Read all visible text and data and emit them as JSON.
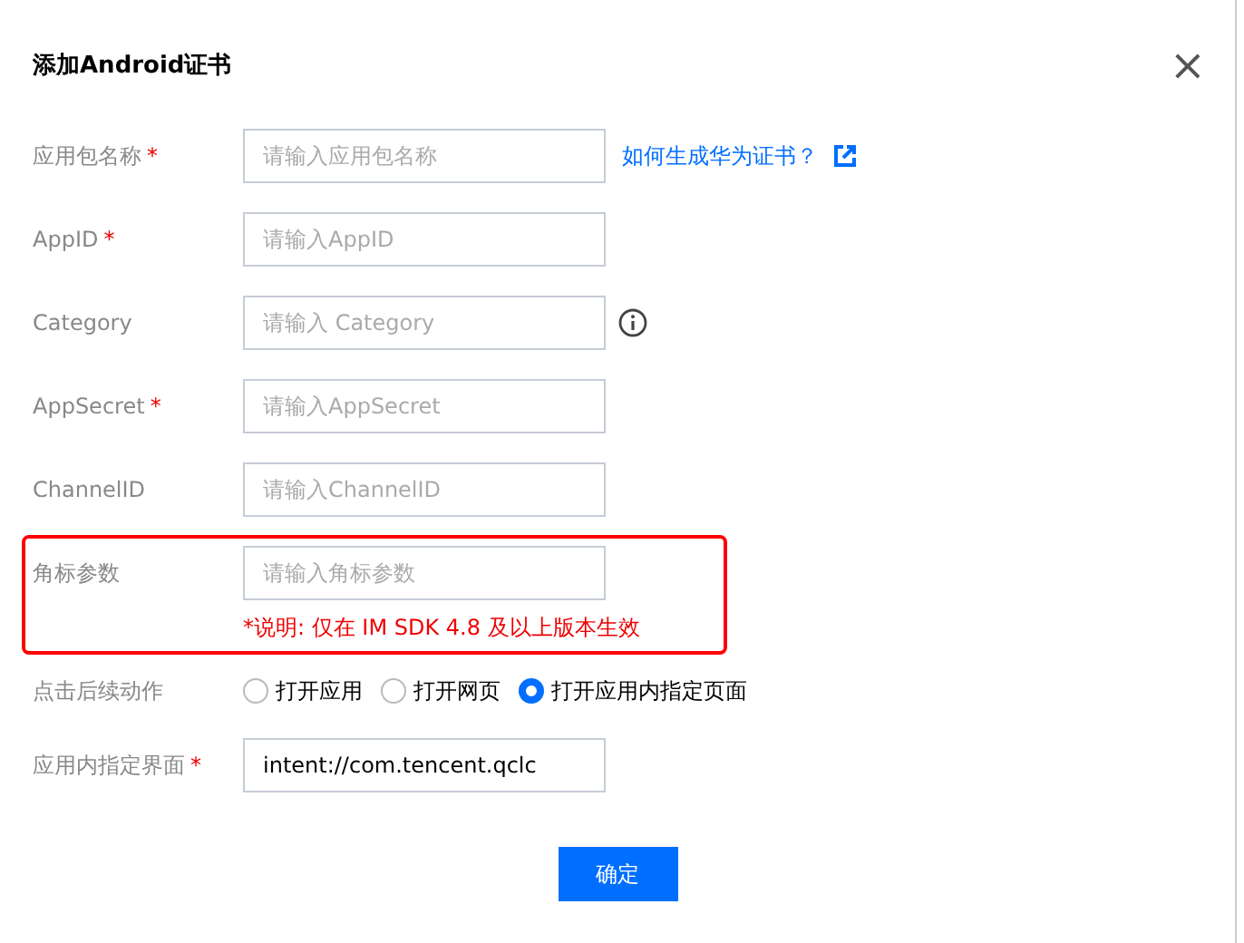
{
  "dialog": {
    "title": "添加Android证书",
    "close": "×"
  },
  "fields": [
    {
      "label": "应用包名称",
      "required": "*",
      "placeholder": "请输入应用包名称",
      "link": "如何生成华为证书？"
    },
    {
      "label": "AppID",
      "required": "*",
      "placeholder": "请输入AppID"
    },
    {
      "label": "Category",
      "placeholder": "请输入 Category",
      "info": true
    },
    {
      "label": "AppSecret",
      "required": "*",
      "placeholder": "请输入AppSecret"
    },
    {
      "label": "ChannelID",
      "placeholder": "请输入ChannelID"
    },
    {
      "label": "角标参数",
      "placeholder": "请输入角标参数",
      "highlighted": true,
      "note": "*说明: 仅在 IM SDK 4.8 及以上版本生效"
    }
  ],
  "action": {
    "label": "点击后续动作",
    "options": [
      {
        "label": "打开应用",
        "selected": false
      },
      {
        "label": "打开网页",
        "selected": false
      },
      {
        "label": "打开应用内指定页面",
        "selected": true
      }
    ]
  },
  "target": {
    "label": "应用内指定界面",
    "required": "*",
    "value": "intent://com.tencent.qclc"
  },
  "confirm": "确定"
}
